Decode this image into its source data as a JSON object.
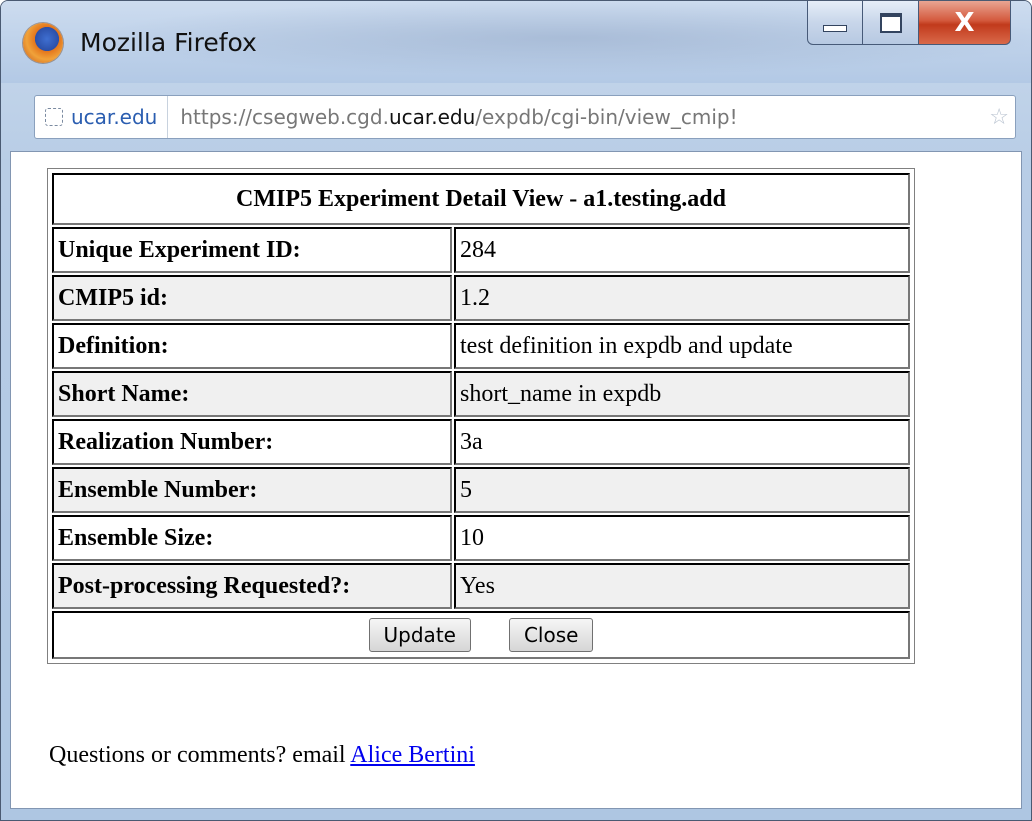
{
  "window": {
    "title": "Mozilla Firefox",
    "close_glyph": "X"
  },
  "address_bar": {
    "site_identity": "ucar.edu",
    "url_prefix": "https://csegweb.cgd.",
    "url_domain": "ucar.edu",
    "url_suffix": "/expdb/cgi-bin/view_cmip!",
    "star_glyph": "☆"
  },
  "detail": {
    "heading": "CMIP5 Experiment Detail View - a1.testing.add",
    "rows": [
      {
        "label": "Unique Experiment ID:",
        "value": "284"
      },
      {
        "label": "CMIP5 id:",
        "value": "1.2"
      },
      {
        "label": "Definition:",
        "value": "test definition in expdb and update"
      },
      {
        "label": "Short Name:",
        "value": "short_name in expdb"
      },
      {
        "label": "Realization Number:",
        "value": "3a"
      },
      {
        "label": "Ensemble Number:",
        "value": "5"
      },
      {
        "label": "Ensemble Size:",
        "value": "10"
      },
      {
        "label": "Post-processing Requested?:",
        "value": "Yes"
      }
    ],
    "update_label": "Update",
    "close_label": "Close"
  },
  "footer": {
    "text": "Questions or comments? email ",
    "link_text": "Alice Bertini"
  }
}
